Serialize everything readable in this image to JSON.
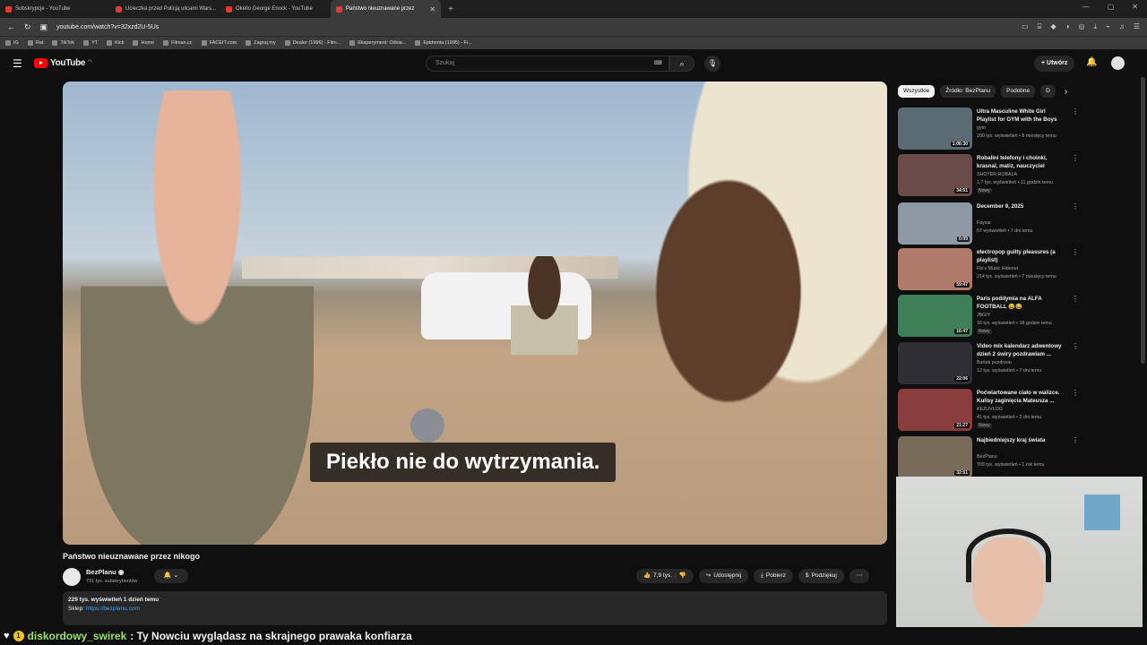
{
  "browser": {
    "tabs": [
      {
        "label": "Subskrypcje - YouTube",
        "active": false
      },
      {
        "label": "Ucieczka przed Policją ulicami Wars...",
        "active": false
      },
      {
        "label": "Okello George Enock - YouTube",
        "active": false
      },
      {
        "label": "Państwo nieuznawane przez",
        "active": true
      }
    ],
    "url": "youtube.com/watch?v=32xzd2U-5Us",
    "bookmarks": [
      "IG",
      "Rat",
      "TikTok",
      "YT",
      "Kick",
      "Home",
      "Filman.cc",
      "FACEIT.com",
      "Zagraj.my",
      "Dealer (1996) - Film...",
      "Eksperyment: Odsia...",
      "Epidemia (1995) - Fi..."
    ]
  },
  "header": {
    "logo_text": "YouTube",
    "logo_country": "PL",
    "search_placeholder": "Szukaj",
    "create_label": "Utwórz"
  },
  "video": {
    "caption": "Piekło nie do wytrzymania.",
    "title": "Państwo nieuznawane przez nikogo",
    "channel": "BezPlanu",
    "subscribers": "731 tys. subskrybentów",
    "likes": "7,9 tys.",
    "share_label": "Udostępnij",
    "download_label": "Pobierz",
    "thanks_label": "Podziękuj",
    "description": {
      "stats": "229 tys. wyświetleń  1 dzień temu",
      "shop_prefix": "Sklep: ",
      "shop_link": "https://bezplanu.com"
    }
  },
  "sidebar": {
    "chips": [
      {
        "label": "Wszystkie",
        "active": true
      },
      {
        "label": "Źródło: BezPlanu",
        "active": false
      },
      {
        "label": "Podobne",
        "active": false
      },
      {
        "label": "D",
        "active": false
      }
    ],
    "recommendations": [
      {
        "title": "Ultra Masculine White Girl Playlist for GYM with the Boys",
        "channel": "gym",
        "meta": "200 tys. wyświetleń • 8 miesięcy temu",
        "duration": "1:06:30",
        "badge": "",
        "thumb_color": "#5a6b73"
      },
      {
        "title": "Robalini telefony i choinki, krasnal, matiz, nauczyciel",
        "channel": "SHOTER ROBALA",
        "meta": "1,7 tys. wyświetleń • 11 godzin temu",
        "duration": "34:01",
        "badge": "Nowy",
        "thumb_color": "#6b4a4a"
      },
      {
        "title": "December 9, 2025",
        "channel": "Faysal",
        "meta": "57 wyświetleń • 7 dni temu",
        "duration": "0:09",
        "badge": "",
        "thumb_color": "#8d98a2"
      },
      {
        "title": "electropop guilty pleasures (a playlist)",
        "channel": "Flo's Music Hideout",
        "meta": "214 tys. wyświetleń • 7 miesięcy temu",
        "duration": "59:47",
        "badge": "",
        "thumb_color": "#b07a6a"
      },
      {
        "title": "Paris poddymia na ALFA FOOTBALL 😂😂",
        "channel": "JBGIY",
        "meta": "16 tys. wyświetleń • 18 godzin temu",
        "duration": "16:47",
        "badge": "Nowy",
        "thumb_color": "#3f7f58"
      },
      {
        "title": "Video mix kalendarz adwentowy dzień 2 świry pozdrawiam ...",
        "channel": "Bartek pozdrooo",
        "meta": "12 tys. wyświetleń • 7 dni temu",
        "duration": "22:06",
        "badge": "",
        "thumb_color": "#2f2f35"
      },
      {
        "title": "Poćwiartowane ciało w walizce. Kulisy zaginięcia Mateusza ...",
        "channel": "KEZUVLOG",
        "meta": "41 tys. wyświetleń • 2 dni temu",
        "duration": "21:27",
        "badge": "Nowy",
        "thumb_color": "#8a3d3d"
      },
      {
        "title": "Najbiedniejszy kraj świata",
        "channel": "BezPlanu",
        "meta": "709 tys. wyświetleń • 1 rok temu",
        "duration": "32:51",
        "badge": "",
        "thumb_color": "#7a6c5a"
      }
    ]
  },
  "chat": {
    "user": "diskordowy_swirek",
    "message": ": Ty Nowciu wyglądasz na skrajnego prawaka konfiarza"
  },
  "colors": {
    "accent": "#ff0000",
    "link": "#3ea6ff",
    "chat_user": "#9be15d"
  }
}
